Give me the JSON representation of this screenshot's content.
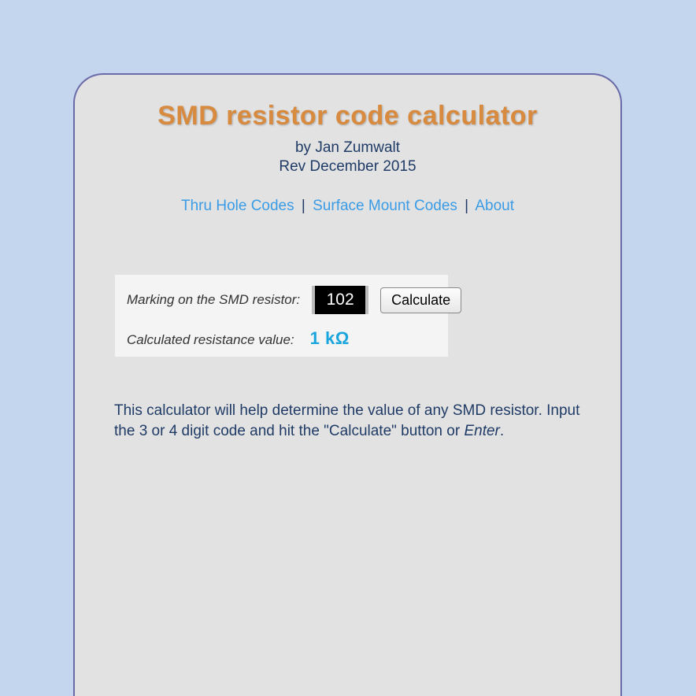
{
  "header": {
    "title": "SMD resistor code calculator",
    "author_line": "by Jan Zumwalt",
    "revision_line": "Rev December 2015"
  },
  "nav": {
    "thru_hole": "Thru Hole Codes",
    "surface_mount": "Surface Mount Codes",
    "about": "About"
  },
  "form": {
    "marking_label": "Marking on the SMD resistor:",
    "marking_value": "102",
    "calculate_button": "Calculate",
    "result_label": "Calculated resistance value:",
    "result_value": "1 kΩ"
  },
  "description": {
    "text_part1": "This calculator will help determine the value of any SMD resistor. Input the 3 or 4 digit code and hit the \"Calculate\" button or ",
    "text_em": "Enter",
    "text_part2": "."
  }
}
